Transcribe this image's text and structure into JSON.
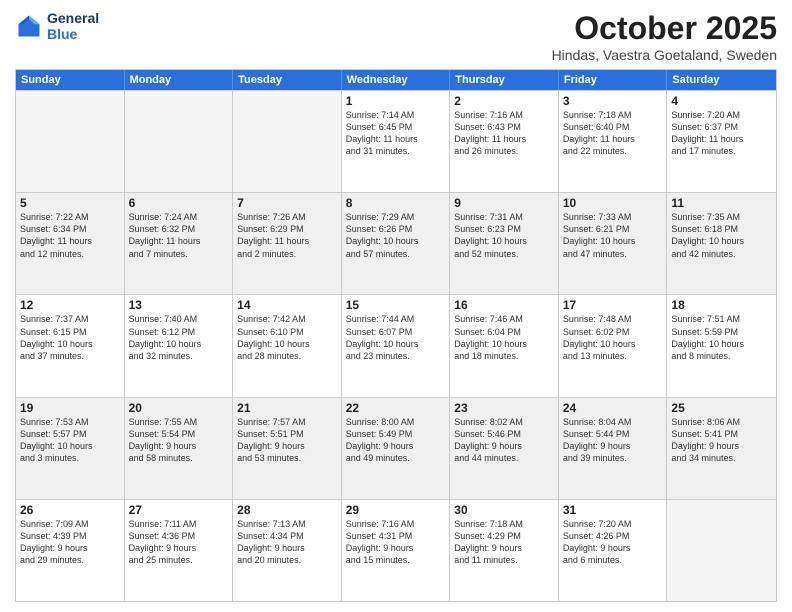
{
  "header": {
    "logo_line1": "General",
    "logo_line2": "Blue",
    "title": "October 2025",
    "subtitle": "Hindas, Vaestra Goetaland, Sweden"
  },
  "days": [
    "Sunday",
    "Monday",
    "Tuesday",
    "Wednesday",
    "Thursday",
    "Friday",
    "Saturday"
  ],
  "rows": [
    [
      {
        "day": "",
        "lines": []
      },
      {
        "day": "",
        "lines": []
      },
      {
        "day": "",
        "lines": []
      },
      {
        "day": "1",
        "lines": [
          "Sunrise: 7:14 AM",
          "Sunset: 6:45 PM",
          "Daylight: 11 hours",
          "and 31 minutes."
        ]
      },
      {
        "day": "2",
        "lines": [
          "Sunrise: 7:16 AM",
          "Sunset: 6:43 PM",
          "Daylight: 11 hours",
          "and 26 minutes."
        ]
      },
      {
        "day": "3",
        "lines": [
          "Sunrise: 7:18 AM",
          "Sunset: 6:40 PM",
          "Daylight: 11 hours",
          "and 22 minutes."
        ]
      },
      {
        "day": "4",
        "lines": [
          "Sunrise: 7:20 AM",
          "Sunset: 6:37 PM",
          "Daylight: 11 hours",
          "and 17 minutes."
        ]
      }
    ],
    [
      {
        "day": "5",
        "lines": [
          "Sunrise: 7:22 AM",
          "Sunset: 6:34 PM",
          "Daylight: 11 hours",
          "and 12 minutes."
        ]
      },
      {
        "day": "6",
        "lines": [
          "Sunrise: 7:24 AM",
          "Sunset: 6:32 PM",
          "Daylight: 11 hours",
          "and 7 minutes."
        ]
      },
      {
        "day": "7",
        "lines": [
          "Sunrise: 7:26 AM",
          "Sunset: 6:29 PM",
          "Daylight: 11 hours",
          "and 2 minutes."
        ]
      },
      {
        "day": "8",
        "lines": [
          "Sunrise: 7:29 AM",
          "Sunset: 6:26 PM",
          "Daylight: 10 hours",
          "and 57 minutes."
        ]
      },
      {
        "day": "9",
        "lines": [
          "Sunrise: 7:31 AM",
          "Sunset: 6:23 PM",
          "Daylight: 10 hours",
          "and 52 minutes."
        ]
      },
      {
        "day": "10",
        "lines": [
          "Sunrise: 7:33 AM",
          "Sunset: 6:21 PM",
          "Daylight: 10 hours",
          "and 47 minutes."
        ]
      },
      {
        "day": "11",
        "lines": [
          "Sunrise: 7:35 AM",
          "Sunset: 6:18 PM",
          "Daylight: 10 hours",
          "and 42 minutes."
        ]
      }
    ],
    [
      {
        "day": "12",
        "lines": [
          "Sunrise: 7:37 AM",
          "Sunset: 6:15 PM",
          "Daylight: 10 hours",
          "and 37 minutes."
        ]
      },
      {
        "day": "13",
        "lines": [
          "Sunrise: 7:40 AM",
          "Sunset: 6:12 PM",
          "Daylight: 10 hours",
          "and 32 minutes."
        ]
      },
      {
        "day": "14",
        "lines": [
          "Sunrise: 7:42 AM",
          "Sunset: 6:10 PM",
          "Daylight: 10 hours",
          "and 28 minutes."
        ]
      },
      {
        "day": "15",
        "lines": [
          "Sunrise: 7:44 AM",
          "Sunset: 6:07 PM",
          "Daylight: 10 hours",
          "and 23 minutes."
        ]
      },
      {
        "day": "16",
        "lines": [
          "Sunrise: 7:46 AM",
          "Sunset: 6:04 PM",
          "Daylight: 10 hours",
          "and 18 minutes."
        ]
      },
      {
        "day": "17",
        "lines": [
          "Sunrise: 7:48 AM",
          "Sunset: 6:02 PM",
          "Daylight: 10 hours",
          "and 13 minutes."
        ]
      },
      {
        "day": "18",
        "lines": [
          "Sunrise: 7:51 AM",
          "Sunset: 5:59 PM",
          "Daylight: 10 hours",
          "and 8 minutes."
        ]
      }
    ],
    [
      {
        "day": "19",
        "lines": [
          "Sunrise: 7:53 AM",
          "Sunset: 5:57 PM",
          "Daylight: 10 hours",
          "and 3 minutes."
        ]
      },
      {
        "day": "20",
        "lines": [
          "Sunrise: 7:55 AM",
          "Sunset: 5:54 PM",
          "Daylight: 9 hours",
          "and 58 minutes."
        ]
      },
      {
        "day": "21",
        "lines": [
          "Sunrise: 7:57 AM",
          "Sunset: 5:51 PM",
          "Daylight: 9 hours",
          "and 53 minutes."
        ]
      },
      {
        "day": "22",
        "lines": [
          "Sunrise: 8:00 AM",
          "Sunset: 5:49 PM",
          "Daylight: 9 hours",
          "and 49 minutes."
        ]
      },
      {
        "day": "23",
        "lines": [
          "Sunrise: 8:02 AM",
          "Sunset: 5:46 PM",
          "Daylight: 9 hours",
          "and 44 minutes."
        ]
      },
      {
        "day": "24",
        "lines": [
          "Sunrise: 8:04 AM",
          "Sunset: 5:44 PM",
          "Daylight: 9 hours",
          "and 39 minutes."
        ]
      },
      {
        "day": "25",
        "lines": [
          "Sunrise: 8:06 AM",
          "Sunset: 5:41 PM",
          "Daylight: 9 hours",
          "and 34 minutes."
        ]
      }
    ],
    [
      {
        "day": "26",
        "lines": [
          "Sunrise: 7:09 AM",
          "Sunset: 4:39 PM",
          "Daylight: 9 hours",
          "and 29 minutes."
        ]
      },
      {
        "day": "27",
        "lines": [
          "Sunrise: 7:11 AM",
          "Sunset: 4:36 PM",
          "Daylight: 9 hours",
          "and 25 minutes."
        ]
      },
      {
        "day": "28",
        "lines": [
          "Sunrise: 7:13 AM",
          "Sunset: 4:34 PM",
          "Daylight: 9 hours",
          "and 20 minutes."
        ]
      },
      {
        "day": "29",
        "lines": [
          "Sunrise: 7:16 AM",
          "Sunset: 4:31 PM",
          "Daylight: 9 hours",
          "and 15 minutes."
        ]
      },
      {
        "day": "30",
        "lines": [
          "Sunrise: 7:18 AM",
          "Sunset: 4:29 PM",
          "Daylight: 9 hours",
          "and 11 minutes."
        ]
      },
      {
        "day": "31",
        "lines": [
          "Sunrise: 7:20 AM",
          "Sunset: 4:26 PM",
          "Daylight: 9 hours",
          "and 6 minutes."
        ]
      },
      {
        "day": "",
        "lines": []
      }
    ]
  ]
}
